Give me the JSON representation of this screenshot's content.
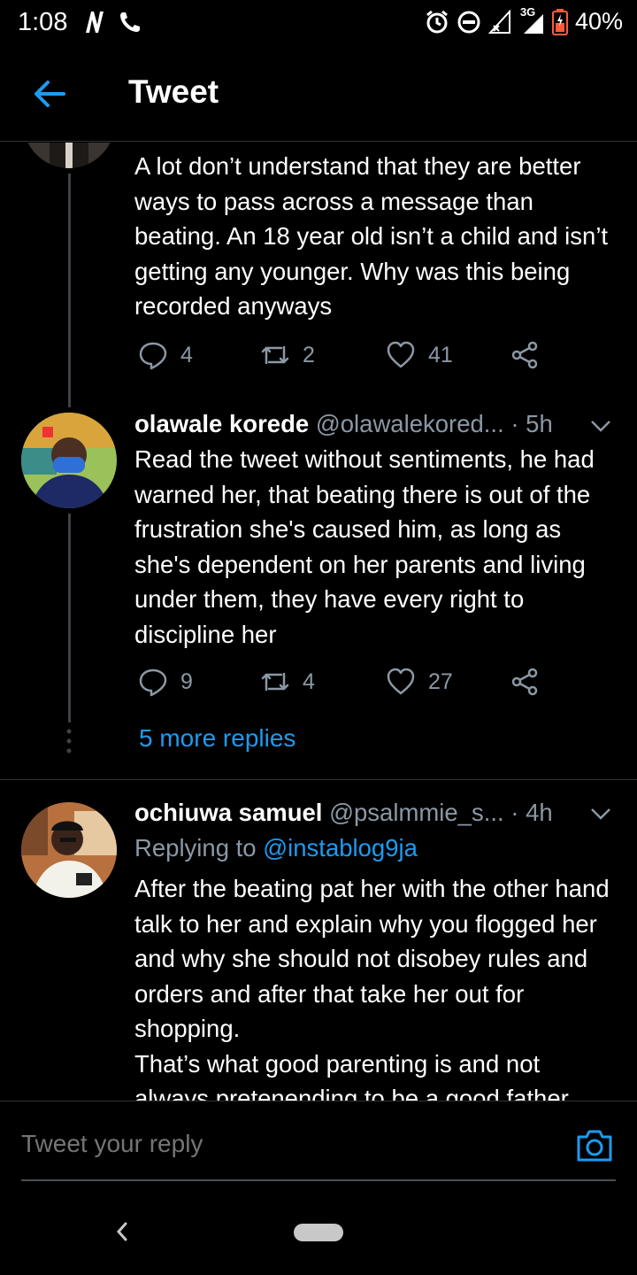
{
  "status": {
    "time": "1:08",
    "network": "3G",
    "battery": "40%"
  },
  "header": {
    "title": "Tweet"
  },
  "tweets": [
    {
      "text": "A lot don’t understand that they are better ways to pass across a message than beating. An 18 year old isn’t a child and isn’t getting any younger. Why was this being recorded anyways",
      "replies": "4",
      "retweets": "2",
      "likes": "41"
    },
    {
      "name": "olawale korede",
      "handle": "@olawalekored...",
      "dot": "·",
      "time": "5h",
      "text": "Read the tweet without sentiments, he had warned her, that beating there is out of the frustration she's caused him, as long as she's dependent on her parents and living under them, they have every right to discipline her",
      "replies": "9",
      "retweets": "4",
      "likes": "27"
    },
    {
      "name": "ochiuwa samuel",
      "handle": "@psalmmie_s...",
      "dot": "·",
      "time": "4h",
      "replying_prefix": "Replying to",
      "replying_to": "@instablog9ja",
      "text": "After the beating pat her with the other hand talk to her and explain why you flogged her and why she should not disobey rules and orders and after that take her out for shopping.",
      "text2": "That’s what good parenting is and not always pretenending to be a good father"
    }
  ],
  "more_replies": "5 more replies",
  "reply_bar": {
    "placeholder": "Tweet your reply"
  },
  "colors": {
    "accent": "#1d9bf0",
    "muted": "#8b98a5",
    "background": "#000000"
  }
}
